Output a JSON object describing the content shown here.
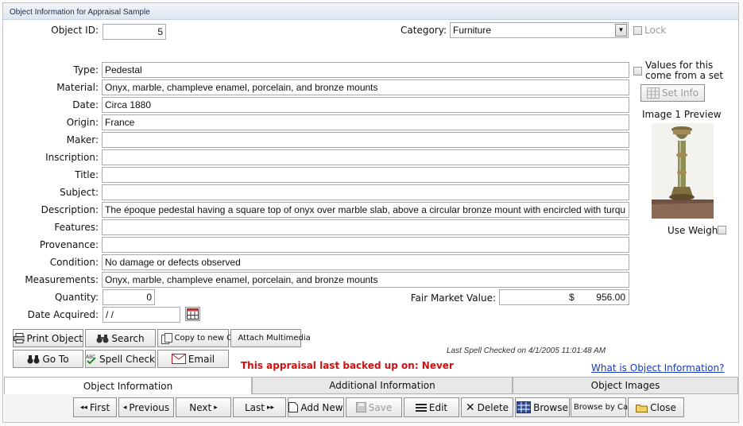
{
  "window": {
    "title": "Object Information for Appraisal Sample"
  },
  "object_id": {
    "label": "Object ID:",
    "value": "5"
  },
  "category": {
    "label": "Category:",
    "value": "Furniture"
  },
  "lock": {
    "label": "Lock"
  },
  "fields": [
    {
      "label": "Type:",
      "value": "Pedestal"
    },
    {
      "label": "Material:",
      "value": "Onyx, marble, champleve enamel, porcelain, and bronze mounts"
    },
    {
      "label": "Date:",
      "value": "Circa 1880"
    },
    {
      "label": "Origin:",
      "value": "France"
    },
    {
      "label": "Maker:",
      "value": ""
    },
    {
      "label": "Inscription:",
      "value": ""
    },
    {
      "label": "Title:",
      "value": ""
    },
    {
      "label": "Subject:",
      "value": ""
    },
    {
      "label": "Description:",
      "value": "The  époque  pedestal having a square top of onyx over marble slab, above a circular  bronze mount with encircled with turqu"
    },
    {
      "label": "Features:",
      "value": ""
    },
    {
      "label": "Provenance:",
      "value": ""
    },
    {
      "label": "Condition:",
      "value": "No damage or defects observed"
    },
    {
      "label": "Measurements:",
      "value": "Onyx, marble, champleve enamel, porcelain, and bronze mounts"
    }
  ],
  "quantity": {
    "label": "Quantity:",
    "value": "0"
  },
  "fair_market_value": {
    "label": "Fair Market Value:",
    "currency": "$",
    "value": "956.00"
  },
  "date_acquired": {
    "label": "Date Acquired:",
    "value": " / /"
  },
  "side": {
    "values_from_set": "Values for this come from a set",
    "set_info": "Set Info",
    "image_preview_title": "Image 1 Preview",
    "use_weight": "Use Weight"
  },
  "action_buttons": {
    "print_object": "Print Object",
    "search": "Search",
    "copy_to_new_object": "Copy to new Object",
    "attach_multimedia": "Attach Multimedia",
    "go_to": "Go To",
    "spell_check": "Spell Check",
    "email": "Email"
  },
  "status": {
    "backup_warning": "This appraisal last backed up on: Never",
    "spell_checked": "Last Spell Checked on  4/1/2005 11:01:48 AM",
    "help_link": "What is Object Information?"
  },
  "tabs": [
    {
      "label": "Object Information",
      "active": true
    },
    {
      "label": "Additional Information",
      "active": false
    },
    {
      "label": "Object Images",
      "active": false
    }
  ],
  "nav": {
    "first": "First",
    "previous": "Previous",
    "next": "Next",
    "last": "Last",
    "add_new": "Add New",
    "save": "Save",
    "edit": "Edit",
    "delete": "Delete",
    "browse": "Browse",
    "browse_by_category": "Browse by Category",
    "close": "Close"
  },
  "colors": {
    "warning": "#d01010",
    "link": "#1a3ab8",
    "tab_active": "#ffffff",
    "tab_inactive": "#e8e8e8"
  }
}
